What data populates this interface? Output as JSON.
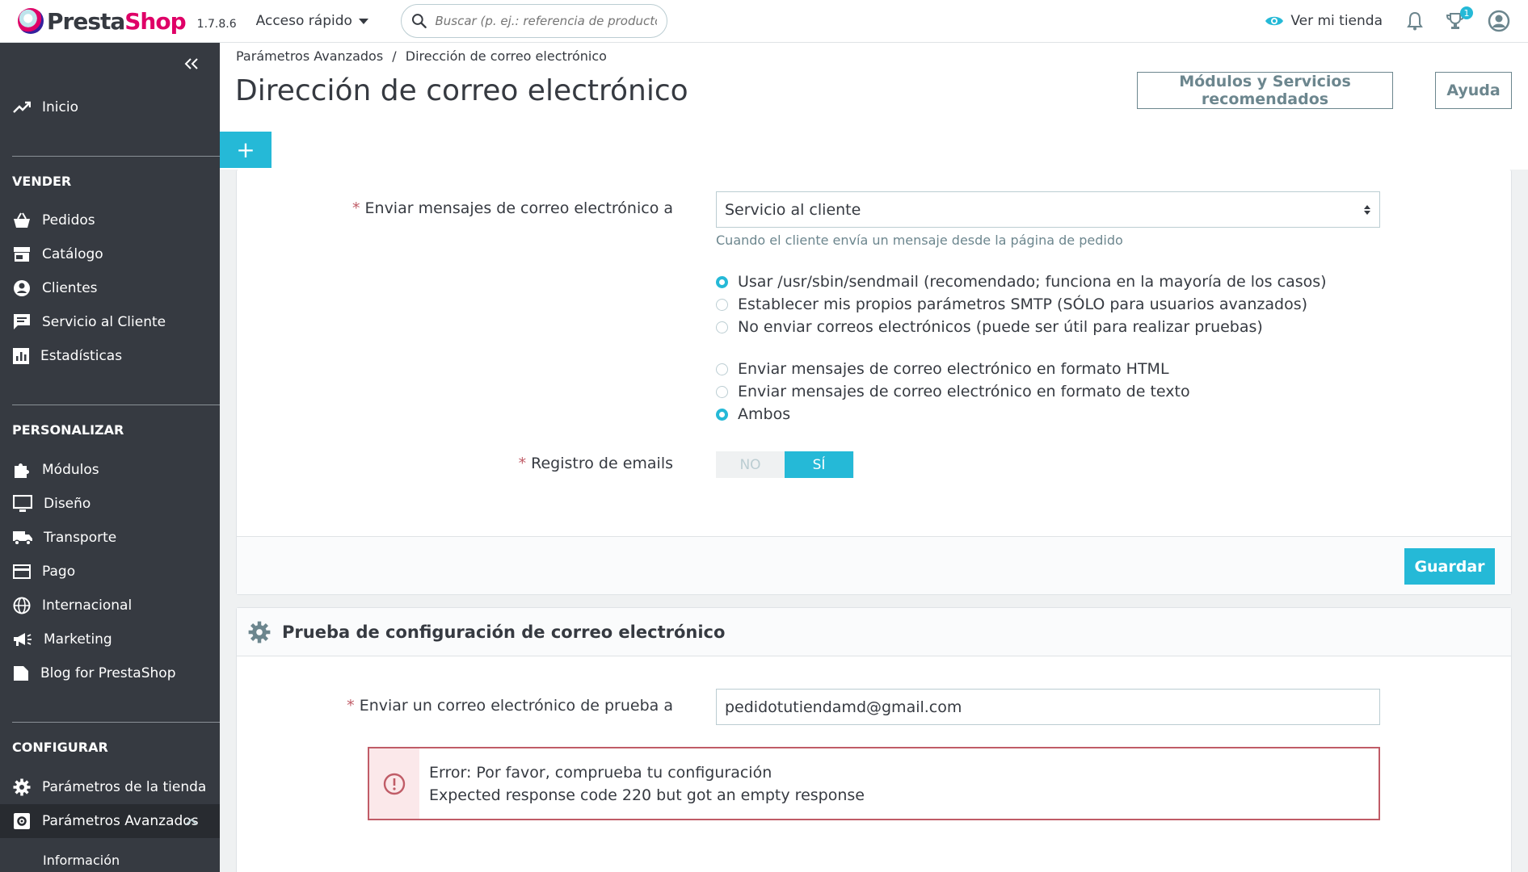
{
  "header": {
    "logo_text_a": "Presta",
    "logo_text_b": "Shop",
    "version": "1.7.8.6",
    "quick_access": "Acceso rápido",
    "search_placeholder": "Buscar (p. ej.: referencia de producto, nombre de cliente…)",
    "view_store": "Ver mi tienda",
    "notifications_badge": "1"
  },
  "sidebar": {
    "inicio": "Inicio",
    "sections": {
      "vender": "VENDER",
      "personalizar": "PERSONALIZAR",
      "configurar": "CONFIGURAR"
    },
    "vender_items": [
      "Pedidos",
      "Catálogo",
      "Clientes",
      "Servicio al Cliente",
      "Estadísticas"
    ],
    "personalizar_items": [
      "Módulos",
      "Diseño",
      "Transporte",
      "Pago",
      "Internacional",
      "Marketing",
      "Blog for PrestaShop"
    ],
    "configurar_items": [
      "Parámetros de la tienda",
      "Parámetros Avanzados"
    ],
    "sub_item": "Información"
  },
  "page": {
    "breadcrumb_parent": "Parámetros Avanzados",
    "breadcrumb_sep": "/",
    "breadcrumb_current": "Dirección de correo electrónico",
    "title": "Dirección de correo electrónico",
    "btn_modules": "Módulos y Servicios recomendados",
    "btn_help": "Ayuda",
    "plus": "+"
  },
  "form": {
    "send_to_label": "Enviar mensajes de correo electrónico a",
    "send_to_value": "Servicio al cliente",
    "send_to_help": "Cuando el cliente envía un mensaje desde la página de pedido",
    "method_options": [
      "Usar /usr/sbin/sendmail (recomendado; funciona en la mayoría de los casos)",
      "Establecer mis propios parámetros SMTP (SÓLO para usuarios avanzados)",
      "No enviar correos electrónicos (puede ser útil para realizar pruebas)"
    ],
    "method_selected": 0,
    "format_options": [
      "Enviar mensajes de correo electrónico en formato HTML",
      "Enviar mensajes de correo electrónico en formato de texto",
      "Ambos"
    ],
    "format_selected": 2,
    "log_label": "Registro de emails",
    "switch_off": "NO",
    "switch_on": "SÍ",
    "save": "Guardar"
  },
  "test": {
    "title": "Prueba de configuración de correo electrónico",
    "send_test_label": "Enviar un correo electrónico de prueba a",
    "email_value": "pedidotutiendamd@gmail.com",
    "error_line1": "Error: Por favor, comprueba tu configuración",
    "error_line2": "Expected response code 220 but got an empty response"
  },
  "colors": {
    "primary": "#25b9d7",
    "sidebar": "#363a41",
    "danger": "#c05c67",
    "brand": "#df0067"
  }
}
